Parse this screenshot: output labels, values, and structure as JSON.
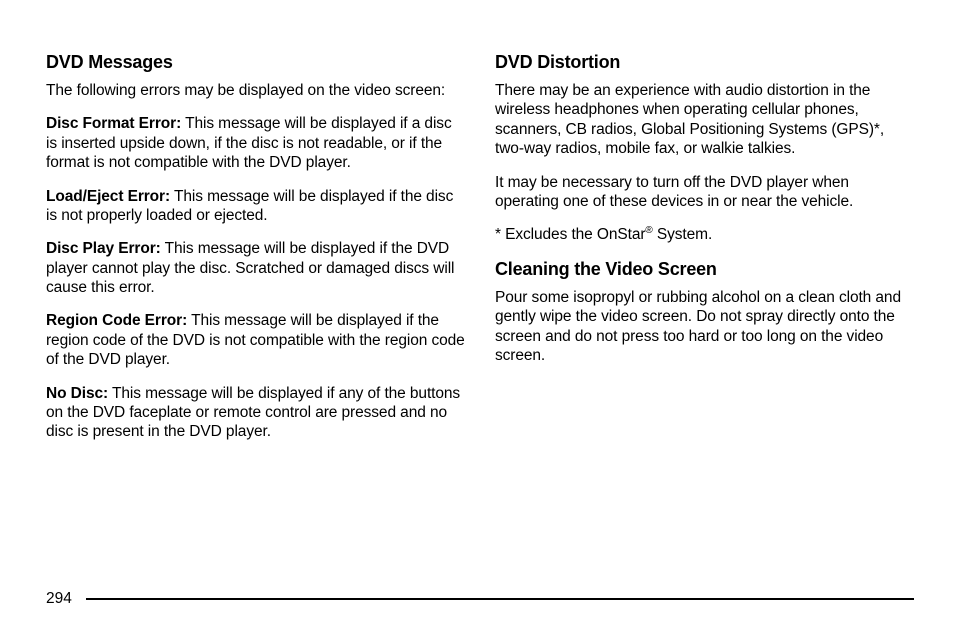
{
  "left": {
    "heading1": "DVD Messages",
    "intro": "The following errors may be displayed on the video screen:",
    "items": [
      {
        "term": "Disc Format Error:",
        "text": "  This message will be displayed if a disc is inserted upside down, if the disc is not readable, or if the format is not compatible with the DVD player."
      },
      {
        "term": "Load/Eject Error:",
        "text": "  This message will be displayed if the disc is not properly loaded or ejected."
      },
      {
        "term": "Disc Play Error:",
        "text": "  This message will be displayed if the DVD player cannot play the disc. Scratched or damaged discs will cause this error."
      },
      {
        "term": "Region Code Error:",
        "text": "  This message will be displayed if the region code of the DVD is not compatible with the region code of the DVD player."
      },
      {
        "term": "No Disc:",
        "text": "  This message will be displayed if any of the buttons on the DVD faceplate or remote control are pressed and no disc is present in the DVD player."
      }
    ]
  },
  "right": {
    "heading1": "DVD Distortion",
    "para1": "There may be an experience with audio distortion in the wireless headphones when operating cellular phones, scanners, CB radios, Global Positioning Systems (GPS)*, two-way radios, mobile fax, or walkie talkies.",
    "para2": "It may be necessary to turn off the DVD player when operating one of these devices in or near the vehicle.",
    "footnote_pre": "* Excludes the OnStar",
    "footnote_sup": "®",
    "footnote_post": " System.",
    "heading2": "Cleaning the Video Screen",
    "para3": "Pour some isopropyl or rubbing alcohol on a clean cloth and gently wipe the video screen. Do not spray directly onto the screen and do not press too hard or too long on the video screen."
  },
  "page_number": "294"
}
